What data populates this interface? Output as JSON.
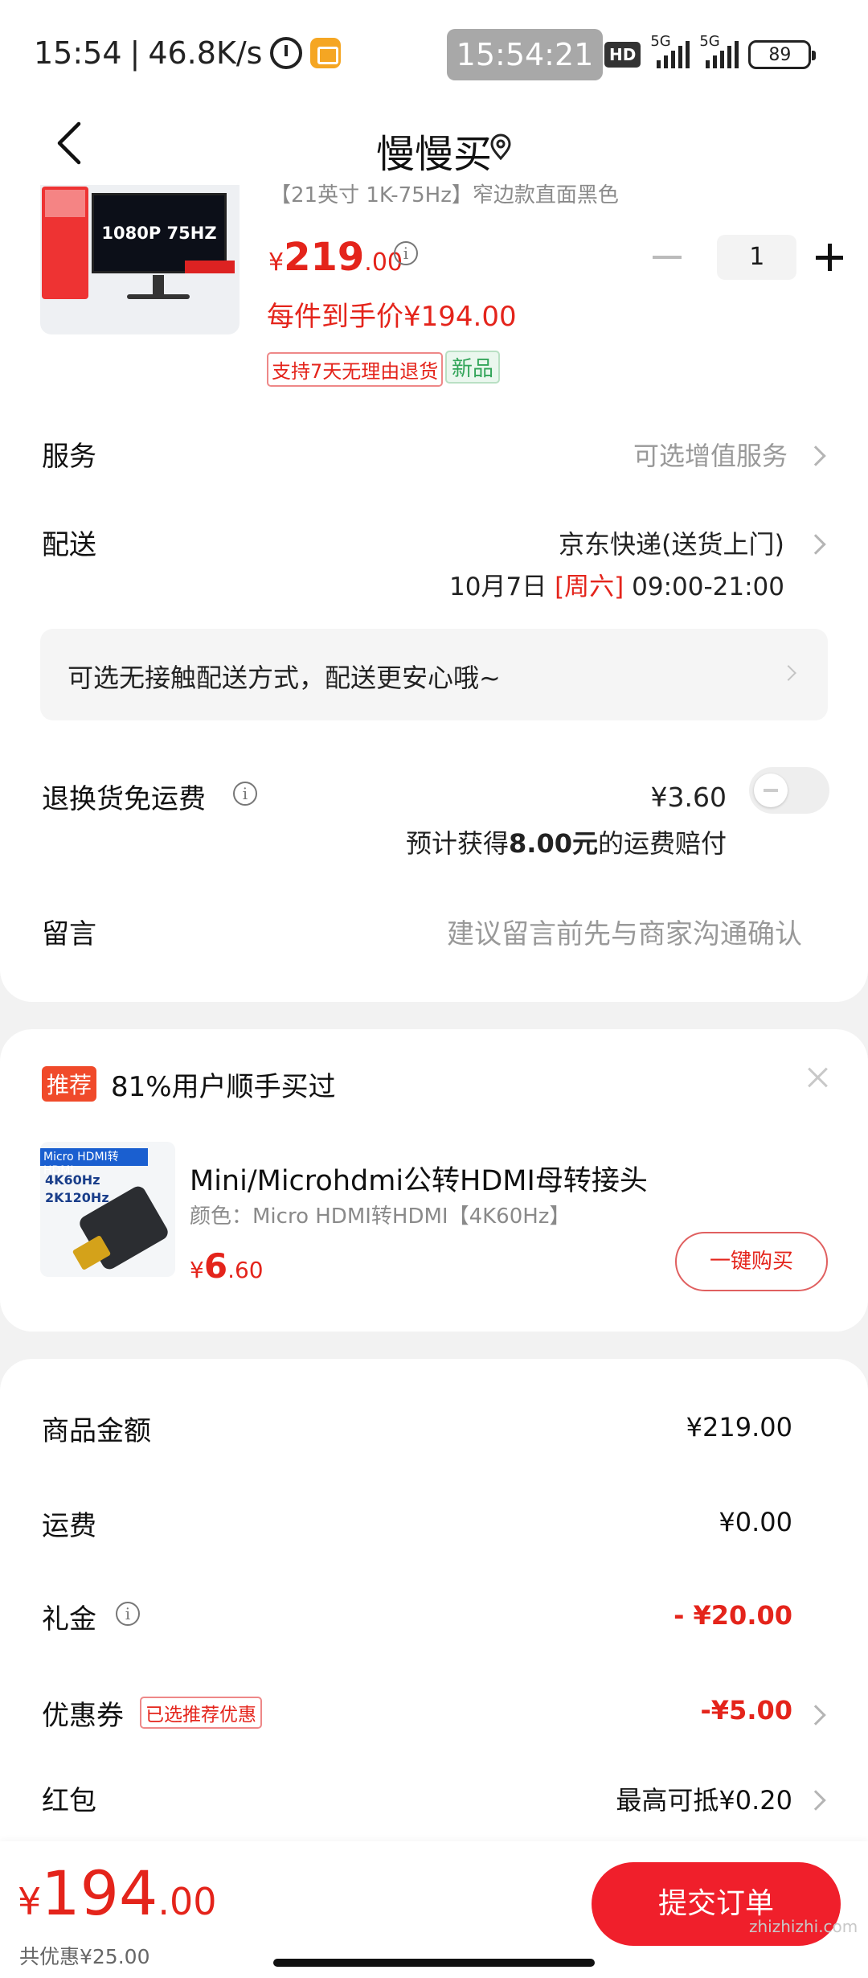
{
  "status_bar": {
    "time": "15:54",
    "speed": "46.8K/s",
    "clock_pill": "15:54:21",
    "hd": "HD",
    "net1": "5G",
    "net2": "5G",
    "battery": "89"
  },
  "header": {
    "title": "慢慢买"
  },
  "product": {
    "name": "【21英寸 1K-75Hz】窄边款直面黑色",
    "thumb_text": "1080P 75HZ",
    "price_yen": "¥",
    "price_int": "219",
    "price_dec": ".00",
    "quantity": "1",
    "unit_price": "每件到手价¥194.00",
    "tag_return": "支持7天无理由退货",
    "tag_new": "新品"
  },
  "service": {
    "label": "服务",
    "value": "可选增值服务"
  },
  "delivery": {
    "label": "配送",
    "method": "京东快递(送货上门)",
    "date": "10月7日",
    "weekday": "[周六]",
    "time": "09:00-21:00"
  },
  "notice": {
    "text": "可选无接触配送方式，配送更安心哦~"
  },
  "return_shipping": {
    "label": "退换货免运费",
    "price": "¥3.60",
    "desc_pre": "预计获得",
    "desc_amount": "8.00元",
    "desc_post": "的运费赔付"
  },
  "message": {
    "label": "留言",
    "placeholder": "建议留言前先与商家沟通确认"
  },
  "recommend": {
    "badge": "推荐",
    "title": "81%用户顺手买过",
    "thumb_label": "Micro HDMI转HDMI",
    "thumb_l2": "4K60Hz",
    "thumb_l3": "2K120Hz",
    "name": "Mini/Microhdmi公转HDMI母转接头",
    "spec": "颜色：Micro HDMI转HDMI【4K60Hz】",
    "price_yen": "¥",
    "price_int": "6",
    "price_dec": ".60",
    "buy": "一键购买"
  },
  "summary": {
    "goods_label": "商品金额",
    "goods_value": "¥219.00",
    "freight_label": "运费",
    "freight_value": "¥0.00",
    "gift_label": "礼金",
    "gift_value": "- ¥20.00",
    "coupon_label": "优惠券",
    "coupon_tag": "已选推荐优惠",
    "coupon_value": "-¥5.00",
    "redpacket_label": "红包",
    "redpacket_value": "最高可抵¥0.20"
  },
  "bottom": {
    "total_yen": "¥",
    "total_int": "194",
    "total_dec": ".00",
    "saved": "共优惠¥25.00",
    "submit": "提交订单",
    "watermark": "zhizhizhi.com"
  }
}
